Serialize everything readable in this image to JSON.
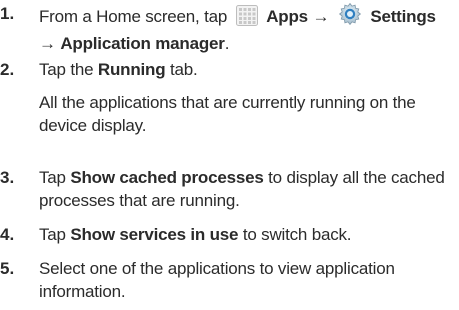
{
  "steps": [
    {
      "number": "1.",
      "prefix": "From a Home screen, tap",
      "apps_label": "Apps",
      "arrow": "→",
      "settings_label": "Settings",
      "app_manager_label": "Application manager",
      "end": "."
    },
    {
      "number": "2.",
      "prefix": "Tap the",
      "bold": "Running",
      "suffix": "tab.",
      "note_line1": "All the applications that are currently running on the",
      "note_line2": "device display."
    },
    {
      "number": "3.",
      "prefix": "Tap",
      "bold": "Show cached processes",
      "suffix": "to display all the cached",
      "line2": "processes that are running."
    },
    {
      "number": "4.",
      "prefix": "Tap",
      "bold": "Show services in use",
      "suffix": "to switch back."
    },
    {
      "number": "5.",
      "line1": "Select one of the applications to view application",
      "line2": "information."
    }
  ],
  "icons": {
    "apps": "apps-grid-icon",
    "settings": "settings-gear-icon"
  }
}
